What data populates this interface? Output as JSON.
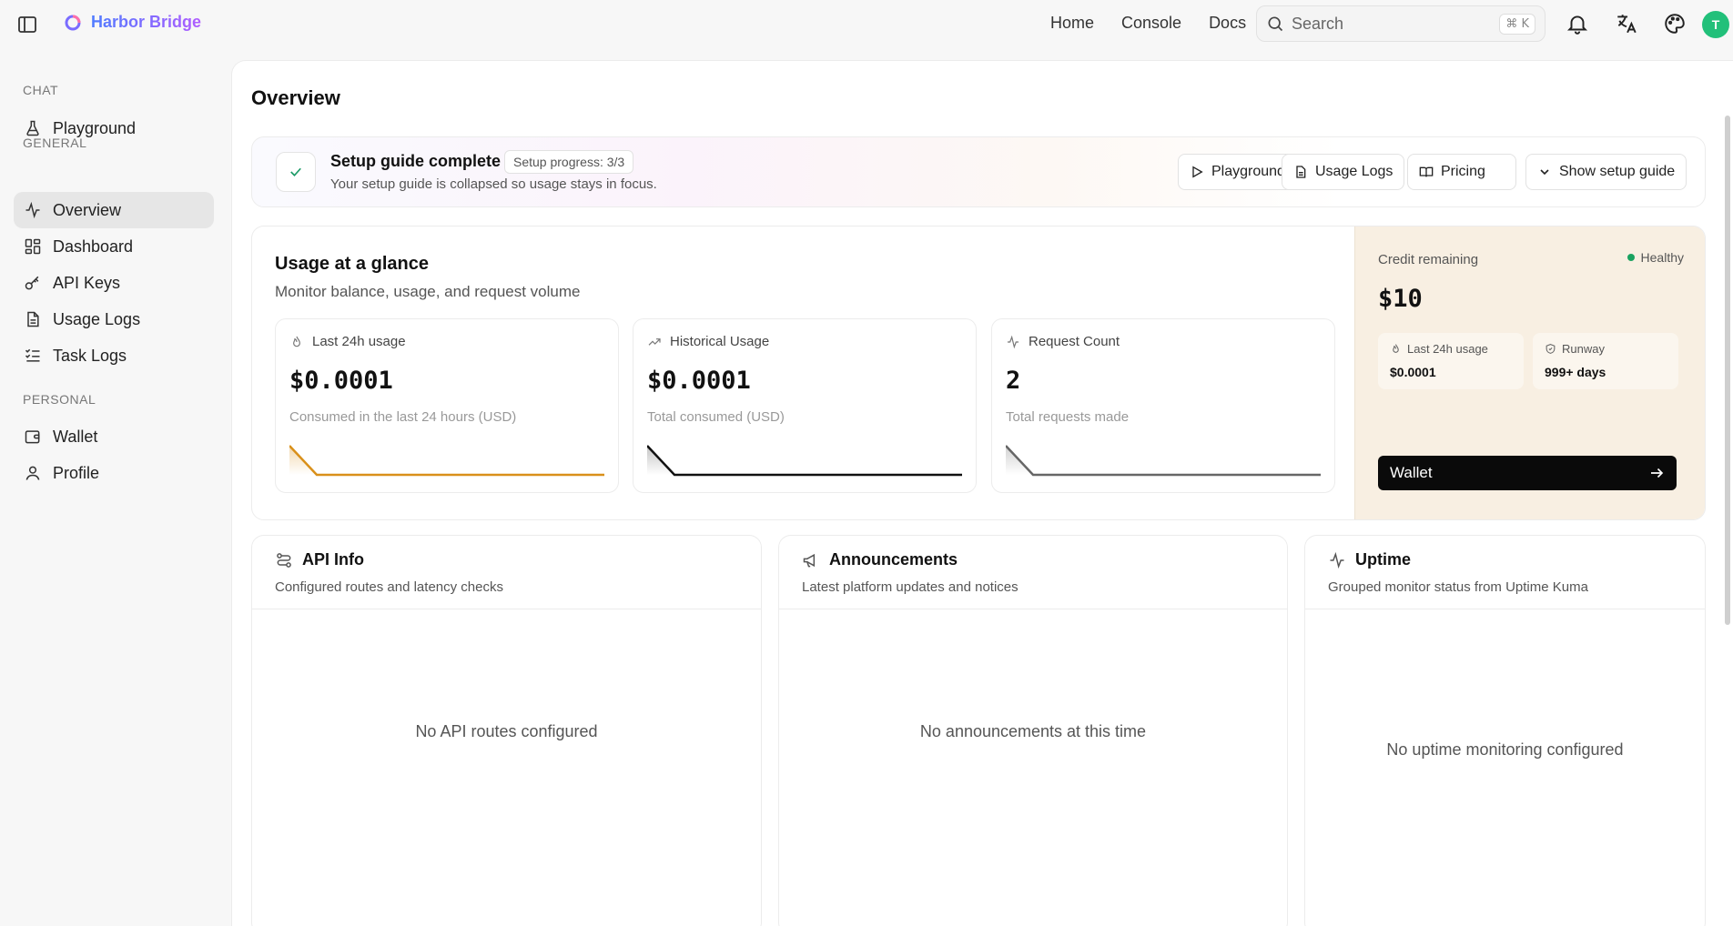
{
  "brand": {
    "name": "Harbor Bridge"
  },
  "topnav": {
    "home": "Home",
    "console": "Console",
    "docs": "Docs"
  },
  "search": {
    "placeholder": "Search",
    "shortcut": "⌘ K"
  },
  "user": {
    "initial": "T"
  },
  "sidebar": {
    "section_chat": "CHAT",
    "section_general": "GENERAL",
    "section_personal": "PERSONAL",
    "items": [
      {
        "label": "Playground",
        "icon": "flask-icon"
      },
      {
        "label": "Overview",
        "icon": "activity-icon",
        "active": true
      },
      {
        "label": "Dashboard",
        "icon": "dashboard-icon"
      },
      {
        "label": "API Keys",
        "icon": "key-icon"
      },
      {
        "label": "Usage Logs",
        "icon": "file-text-icon"
      },
      {
        "label": "Task Logs",
        "icon": "list-check-icon"
      },
      {
        "label": "Wallet",
        "icon": "wallet-icon"
      },
      {
        "label": "Profile",
        "icon": "user-icon"
      }
    ]
  },
  "page": {
    "title": "Overview"
  },
  "setup": {
    "title": "Setup guide complete",
    "badge": "Setup progress: 3/3",
    "subtitle": "Your setup guide is collapsed so usage stays in focus.",
    "buttons": {
      "playground": "Playground",
      "usage_logs": "Usage Logs",
      "pricing": "Pricing",
      "show_guide": "Show setup guide"
    }
  },
  "usage": {
    "title": "Usage at a glance",
    "subtitle": "Monitor balance, usage, and request volume",
    "metrics": [
      {
        "label": "Last 24h usage",
        "value": "$0.0001",
        "sub": "Consumed in the last 24 hours (USD)",
        "color": "#d9901a"
      },
      {
        "label": "Historical Usage",
        "value": "$0.0001",
        "sub": "Total consumed (USD)",
        "color": "#111111"
      },
      {
        "label": "Request Count",
        "value": "2",
        "sub": "Total requests made",
        "color": "#666666"
      }
    ]
  },
  "credit": {
    "label": "Credit remaining",
    "status": "Healthy",
    "status_color": "#1aa260",
    "value": "$10",
    "last24_label": "Last 24h usage",
    "last24_value": "$0.0001",
    "runway_label": "Runway",
    "runway_value": "999+ days",
    "wallet_button": "Wallet"
  },
  "panels": {
    "api": {
      "title": "API Info",
      "subtitle": "Configured routes and latency checks",
      "empty": "No API routes configured"
    },
    "announcements": {
      "title": "Announcements",
      "subtitle": "Latest platform updates and notices",
      "empty": "No announcements at this time"
    },
    "uptime": {
      "title": "Uptime",
      "subtitle": "Grouped monitor status from Uptime Kuma",
      "empty": "No uptime monitoring configured"
    }
  }
}
